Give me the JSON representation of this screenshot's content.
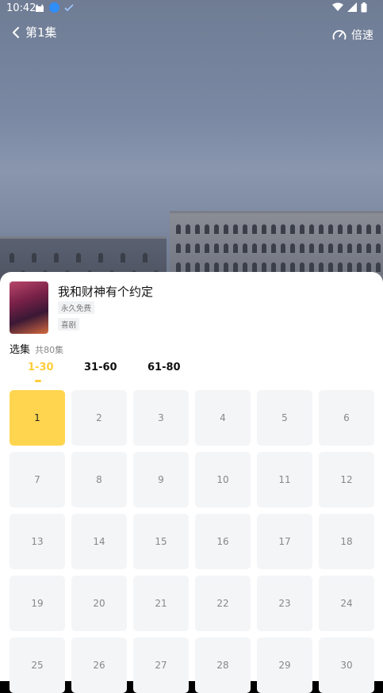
{
  "status_bar": {
    "time": "10:42"
  },
  "header": {
    "episode_title": "第1集",
    "speed_label": "倍速"
  },
  "drama": {
    "title": "我和财神有个约定",
    "tags": [
      "永久免费",
      "喜剧"
    ]
  },
  "episodes": {
    "section_label": "选集",
    "total_label": "共80集",
    "tabs": [
      {
        "label": "1-30",
        "active": true
      },
      {
        "label": "31-60",
        "active": false
      },
      {
        "label": "61-80",
        "active": false
      }
    ],
    "items": [
      "1",
      "2",
      "3",
      "4",
      "5",
      "6",
      "7",
      "8",
      "9",
      "10",
      "11",
      "12",
      "13",
      "14",
      "15",
      "16",
      "17",
      "18",
      "19",
      "20",
      "21",
      "22",
      "23",
      "24",
      "25",
      "26",
      "27",
      "28",
      "29",
      "30"
    ],
    "current": "1"
  },
  "colors": {
    "accent": "#ffcd3c",
    "active_cell": "#ffd54f",
    "cell_bg": "#f4f5f7"
  }
}
